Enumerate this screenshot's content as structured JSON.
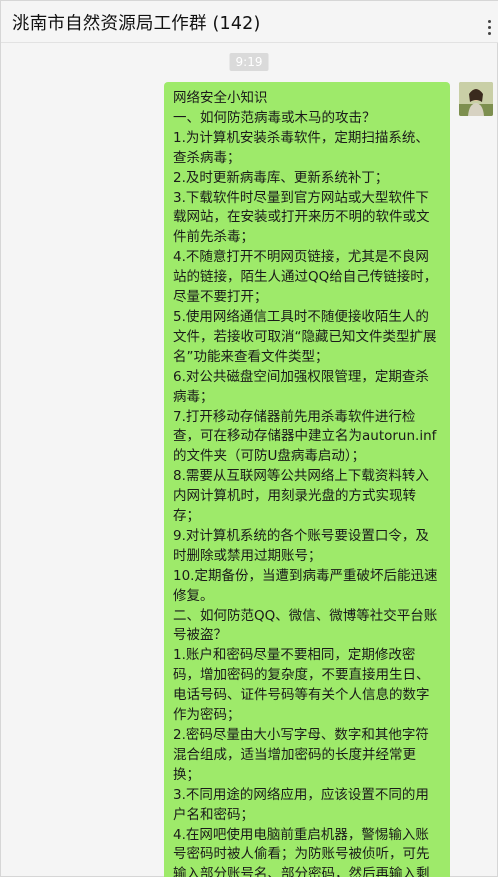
{
  "header": {
    "title": "洮南市自然资源局工作群 (142)",
    "more_icon": "more-dots-icon"
  },
  "timestamp": "9:19",
  "message": {
    "sender_avatar": "user-avatar",
    "bubble_color": "#9eea6a",
    "text": "网络安全小知识\n一、如何防范病毒或木马的攻击？\n1.为计算机安装杀毒软件，定期扫描系统、查杀病毒；\n2.及时更新病毒库、更新系统补丁；\n3.下载软件时尽量到官方网站或大型软件下载网站，在安装或打开来历不明的软件或文件前先杀毒；\n4.不随意打开不明网页链接，尤其是不良网站的链接，陌生人通过QQ给自己传链接时，尽量不要打开；\n5.使用网络通信工具时不随便接收陌生人的文件，若接收可取消“隐藏已知文件类型扩展名”功能来查看文件类型；\n6.对公共磁盘空间加强权限管理，定期查杀病毒；\n7.打开移动存储器前先用杀毒软件进行检查，可在移动存储器中建立名为autorun.inf的文件夹（可防U盘病毒启动）；\n8.需要从互联网等公共网络上下载资料转入内网计算机时，用刻录光盘的方式实现转存；\n9.对计算机系统的各个账号要设置口令，及时删除或禁用过期账号；\n10.定期备份，当遭到病毒严重破坏后能迅速修复。\n二、如何防范QQ、微信、微博等社交平台账号被盗？\n1.账户和密码尽量不要相同，定期修改密码，增加密码的复杂度，不要直接用生日、电话号码、证件号码等有关个人信息的数字作为密码；\n2.密码尽量由大小写字母、数字和其他字符混合组成，适当增加密码的长度并经常更换；\n3.不同用途的网络应用，应该设置不同的用户名和密码；\n4.在网吧使用电脑前重启机器，警惕输入账号密码时被人偷看；为防账号被侦听，可先输入部分账号名、部分密码，然后再输入剩"
  }
}
